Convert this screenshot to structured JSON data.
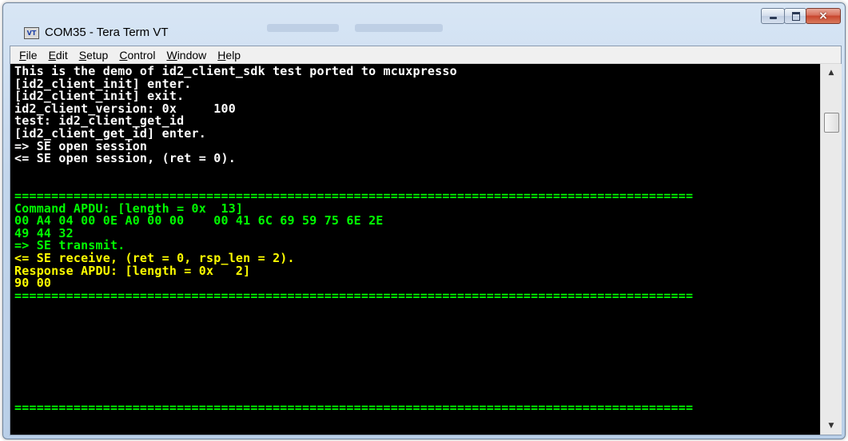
{
  "window": {
    "title": "COM35 - Tera Term VT",
    "app_icon": "VT",
    "controls": {
      "minimize": "minimize-icon",
      "maximize": "maximize-icon",
      "close": "×"
    }
  },
  "menu": [
    {
      "accel": "F",
      "rest": "ile"
    },
    {
      "accel": "E",
      "rest": "dit"
    },
    {
      "accel": "S",
      "rest": "etup"
    },
    {
      "accel": "C",
      "rest": "ontrol"
    },
    {
      "accel": "W",
      "rest": "indow"
    },
    {
      "accel": "H",
      "rest": "elp"
    }
  ],
  "colors": {
    "white_text": "#ffffff",
    "green_text": "#00ff00",
    "yellow_text": "#ffff00",
    "background": "#000000"
  },
  "terminal": {
    "lines": [
      {
        "text": "This is the demo of id2_client_sdk test ported to mcuxpresso",
        "color": "#ffffff"
      },
      {
        "text": "[id2_client_init] enter.",
        "color": "#ffffff"
      },
      {
        "text": "[id2_client_init] exit.",
        "color": "#ffffff"
      },
      {
        "text": "id2_client_version: 0x     100",
        "color": "#ffffff"
      },
      {
        "text": "test: id2_client_get_id",
        "color": "#ffffff"
      },
      {
        "text": "[id2_client_get_id] enter.",
        "color": "#ffffff"
      },
      {
        "text": "=> SE open session",
        "color": "#ffffff"
      },
      {
        "text": "<= SE open session, (ret = 0).",
        "color": "#ffffff"
      },
      {
        "text": "",
        "color": "#ffffff"
      },
      {
        "text": "",
        "color": "#ffffff"
      },
      {
        "text": "============================================================================================",
        "color": "#00ff00"
      },
      {
        "text": "Command APDU: [length = 0x  13]",
        "color": "#00ff00"
      },
      {
        "text": "00 A4 04 00 0E A0 00 00    00 41 6C 69 59 75 6E 2E",
        "color": "#00ff00"
      },
      {
        "text": "49 44 32",
        "color": "#00ff00"
      },
      {
        "text": "=> SE transmit.",
        "color": "#00ff00"
      },
      {
        "text": "<= SE receive, (ret = 0, rsp_len = 2).",
        "color": "#ffff00"
      },
      {
        "text": "Response APDU: [length = 0x   2]",
        "color": "#ffff00"
      },
      {
        "text": "90 00",
        "color": "#ffff00"
      },
      {
        "text": "============================================================================================",
        "color": "#00ff00"
      },
      {
        "text": "",
        "color": "#ffffff"
      },
      {
        "text": "",
        "color": "#ffffff"
      },
      {
        "text": "",
        "color": "#ffffff"
      },
      {
        "text": "",
        "color": "#ffffff"
      },
      {
        "text": "",
        "color": "#ffffff"
      },
      {
        "text": "",
        "color": "#ffffff"
      },
      {
        "text": "",
        "color": "#ffffff"
      },
      {
        "text": "",
        "color": "#ffffff"
      },
      {
        "text": "============================================================================================",
        "color": "#00ff00"
      }
    ]
  },
  "scrollbar": {
    "up": "▲",
    "down": "▼"
  }
}
